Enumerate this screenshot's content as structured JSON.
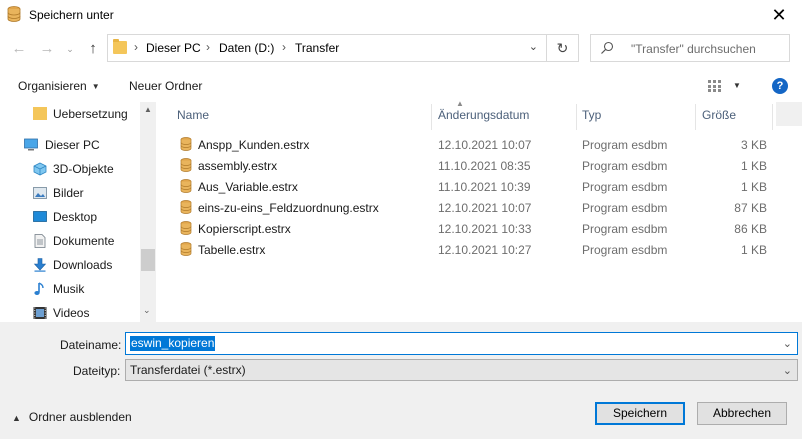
{
  "window": {
    "title": "Speichern unter"
  },
  "address": {
    "crumbs": [
      "Dieser PC",
      "Daten (D:)",
      "Transfer"
    ]
  },
  "search": {
    "placeholder": "\"Transfer\" durchsuchen"
  },
  "toolbar": {
    "organize_label": "Organisieren",
    "new_folder_label": "Neuer Ordner"
  },
  "sidebar": {
    "items": [
      {
        "label": "Uebersetzung",
        "icon": "folder-icon"
      },
      {
        "label": "Dieser PC",
        "icon": "computer-icon"
      },
      {
        "label": "3D-Objekte",
        "icon": "cube-icon"
      },
      {
        "label": "Bilder",
        "icon": "pictures-icon"
      },
      {
        "label": "Desktop",
        "icon": "desktop-icon"
      },
      {
        "label": "Dokumente",
        "icon": "document-icon"
      },
      {
        "label": "Downloads",
        "icon": "download-icon"
      },
      {
        "label": "Musik",
        "icon": "music-icon"
      },
      {
        "label": "Videos",
        "icon": "video-icon"
      }
    ]
  },
  "filelist": {
    "columns": {
      "name": "Name",
      "date": "Änderungsdatum",
      "type": "Typ",
      "size": "Größe"
    },
    "rows": [
      {
        "name": "Anspp_Kunden.estrx",
        "date": "12.10.2021 10:07",
        "type": "Program esdbm",
        "size": "3 KB"
      },
      {
        "name": "assembly.estrx",
        "date": "11.10.2021 08:35",
        "type": "Program esdbm",
        "size": "1 KB"
      },
      {
        "name": "Aus_Variable.estrx",
        "date": "11.10.2021 10:39",
        "type": "Program esdbm",
        "size": "1 KB"
      },
      {
        "name": "eins-zu-eins_Feldzuordnung.estrx",
        "date": "12.10.2021 10:07",
        "type": "Program esdbm",
        "size": "87 KB"
      },
      {
        "name": "Kopierscript.estrx",
        "date": "12.10.2021 10:33",
        "type": "Program esdbm",
        "size": "86 KB"
      },
      {
        "name": "Tabelle.estrx",
        "date": "12.10.2021 10:27",
        "type": "Program esdbm",
        "size": "1 KB"
      }
    ]
  },
  "form": {
    "filename_label": "Dateiname:",
    "filename_value": "eswin_kopieren",
    "filetype_label": "Dateityp:",
    "filetype_value": "Transferdatei (*.estrx)"
  },
  "footer": {
    "hide_folders_label": "Ordner ausblenden",
    "save_label": "Speichern",
    "cancel_label": "Abbrechen"
  },
  "colors": {
    "accent": "#0078d7",
    "folder": "#f4c65a",
    "help": "#1466c5"
  }
}
